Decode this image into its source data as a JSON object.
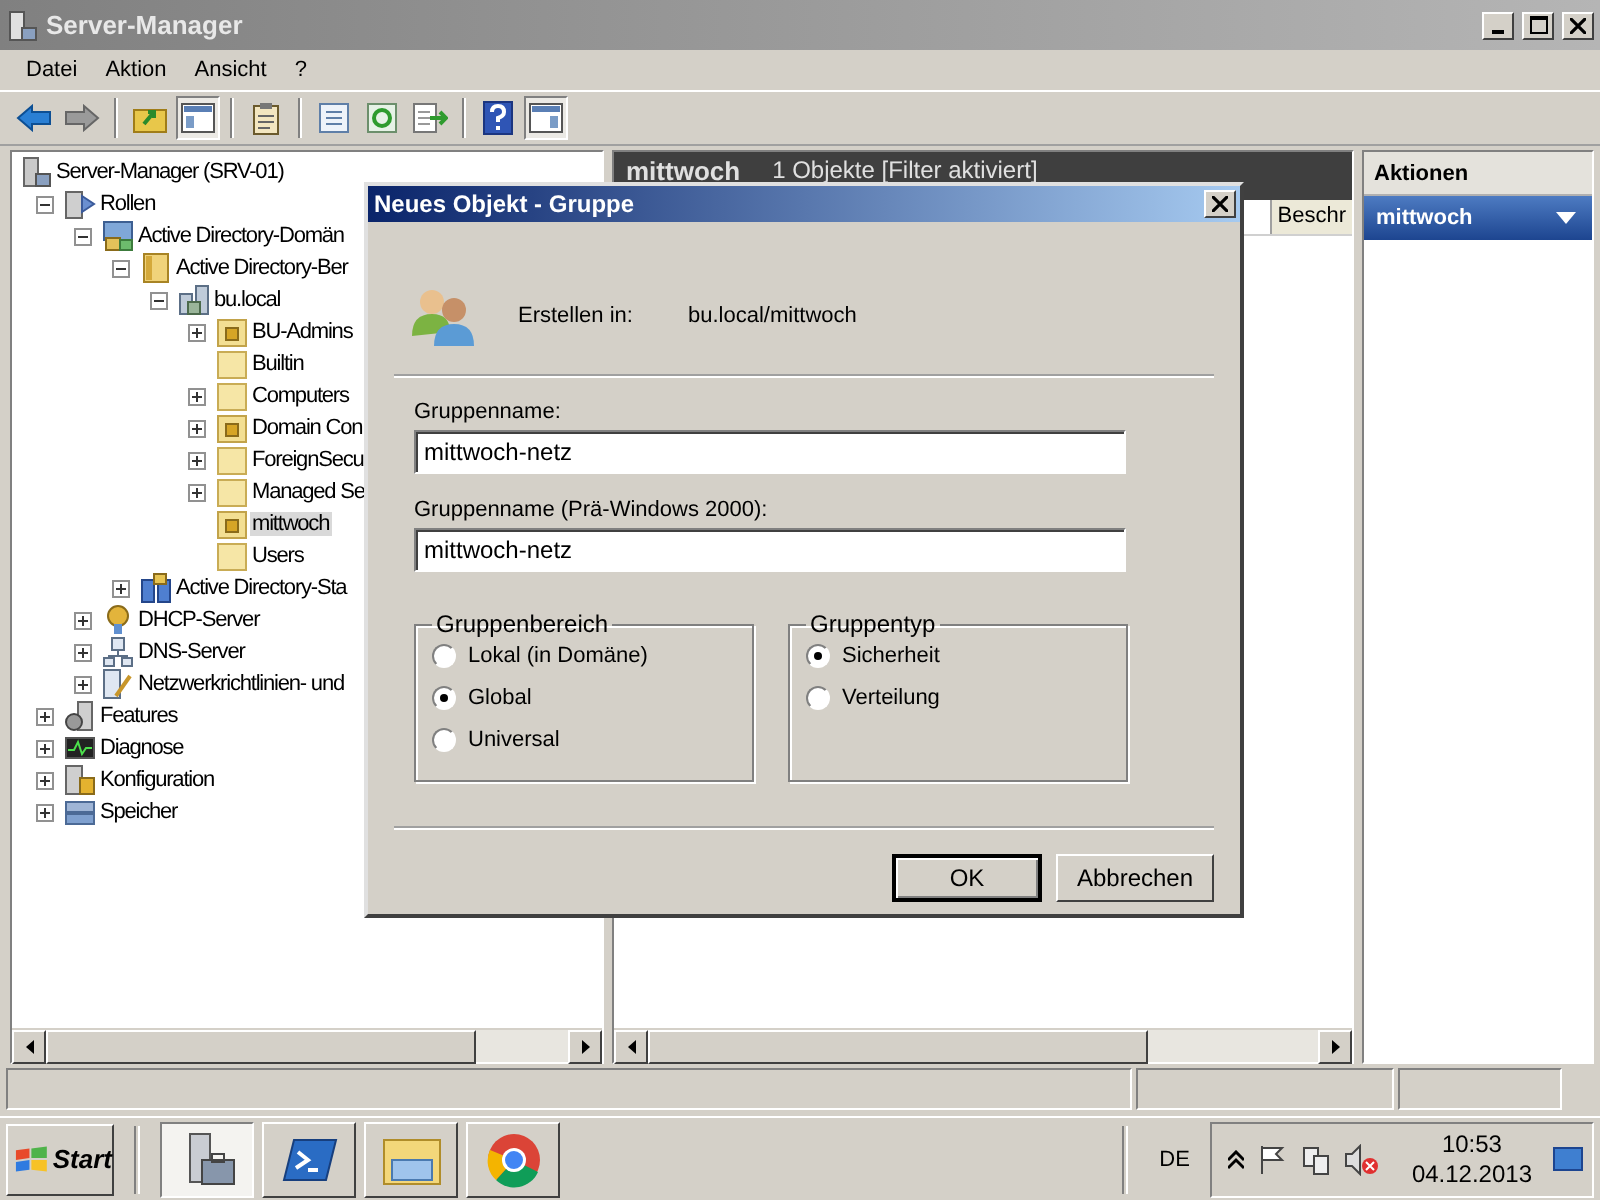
{
  "window": {
    "title": "Server-Manager"
  },
  "menu": [
    "Datei",
    "Aktion",
    "Ansicht",
    "?"
  ],
  "toolbar": [
    {
      "pressed": false
    },
    {
      "pressed": false
    },
    {
      "pressed": false
    },
    {
      "pressed": true
    },
    {
      "pressed": false
    },
    {
      "pressed": false
    },
    {
      "pressed": false
    },
    {
      "pressed": false
    },
    {
      "pressed": false
    },
    {
      "pressed": true
    }
  ],
  "tree": {
    "label": "Server-Manager (SRV-01)",
    "kind": "computer",
    "selected": false,
    "children": [
      {
        "label": "Rollen",
        "kind": "roles",
        "expanded": true,
        "selected": false,
        "children": [
          {
            "label": "Active Directory-Domän",
            "kind": "domain-service",
            "expanded": true,
            "selected": false,
            "children": [
              {
                "label": "Active Directory-Ber",
                "kind": "ad-container",
                "expanded": true,
                "selected": false,
                "children": [
                  {
                    "label": "bu.local",
                    "kind": "domain",
                    "expanded": true,
                    "selected": false,
                    "children": [
                      {
                        "label": "BU-Admins",
                        "kind": "ou",
                        "expanded": false,
                        "selected": false
                      },
                      {
                        "label": "Builtin",
                        "kind": "folder",
                        "selected": false
                      },
                      {
                        "label": "Computers",
                        "kind": "folder",
                        "expanded": false,
                        "selected": false
                      },
                      {
                        "label": "Domain Con",
                        "kind": "ou",
                        "expanded": false,
                        "selected": false
                      },
                      {
                        "label": "ForeignSecu",
                        "kind": "folder",
                        "expanded": false,
                        "selected": false
                      },
                      {
                        "label": "Managed Se",
                        "kind": "folder",
                        "expanded": false,
                        "selected": false
                      },
                      {
                        "label": "mittwoch",
                        "kind": "ou",
                        "selected": true
                      },
                      {
                        "label": "Users",
                        "kind": "folder",
                        "selected": false
                      }
                    ]
                  }
                ]
              },
              {
                "label": "Active Directory-Sta",
                "kind": "sites",
                "expanded": false,
                "selected": false
              }
            ]
          },
          {
            "label": "DHCP-Server",
            "kind": "dhcp",
            "expanded": false,
            "selected": false
          },
          {
            "label": "DNS-Server",
            "kind": "dns",
            "expanded": false,
            "selected": false
          },
          {
            "label": "Netzwerkrichtlinien- und",
            "kind": "policy",
            "expanded": false,
            "selected": false
          }
        ]
      },
      {
        "label": "Features",
        "kind": "features",
        "expanded": false,
        "selected": false
      },
      {
        "label": "Diagnose",
        "kind": "diagnostics",
        "expanded": false,
        "selected": false
      },
      {
        "label": "Konfiguration",
        "kind": "config",
        "expanded": false,
        "selected": false
      },
      {
        "label": "Speicher",
        "kind": "storage",
        "expanded": false,
        "selected": false
      }
    ]
  },
  "list": {
    "title": "mittwoch",
    "info": "1 Objekte  [Filter aktiviert]",
    "columns": [
      "Beschr"
    ]
  },
  "actions": {
    "title": "Aktionen",
    "section": "mittwoch"
  },
  "dialog": {
    "title": "Neues Objekt - Gruppe",
    "create_in_label": "Erstellen in:",
    "create_in_value": "bu.local/mittwoch",
    "fields": [
      {
        "label": "Gruppenname:",
        "value": "mittwoch-netz"
      },
      {
        "label": "Gruppenname (Prä-Windows 2000):",
        "value": "mittwoch-netz"
      }
    ],
    "groups": [
      {
        "title": "Gruppenbereich",
        "options": [
          {
            "label": "Lokal (in Domäne)",
            "selected": false
          },
          {
            "label": "Global",
            "selected": true
          },
          {
            "label": "Universal",
            "selected": false
          }
        ]
      },
      {
        "title": "Gruppentyp",
        "options": [
          {
            "label": "Sicherheit",
            "selected": true
          },
          {
            "label": "Verteilung",
            "selected": false
          }
        ]
      }
    ],
    "buttons": [
      {
        "label": "OK",
        "default": true
      },
      {
        "label": "Abbrechen",
        "default": false
      }
    ]
  },
  "taskbar": {
    "start": "Start",
    "apps": [
      {
        "selected": true
      },
      {
        "selected": false
      },
      {
        "selected": false
      },
      {
        "selected": false
      }
    ],
    "language": "DE",
    "time": "10:53",
    "date": "04.12.2013"
  }
}
